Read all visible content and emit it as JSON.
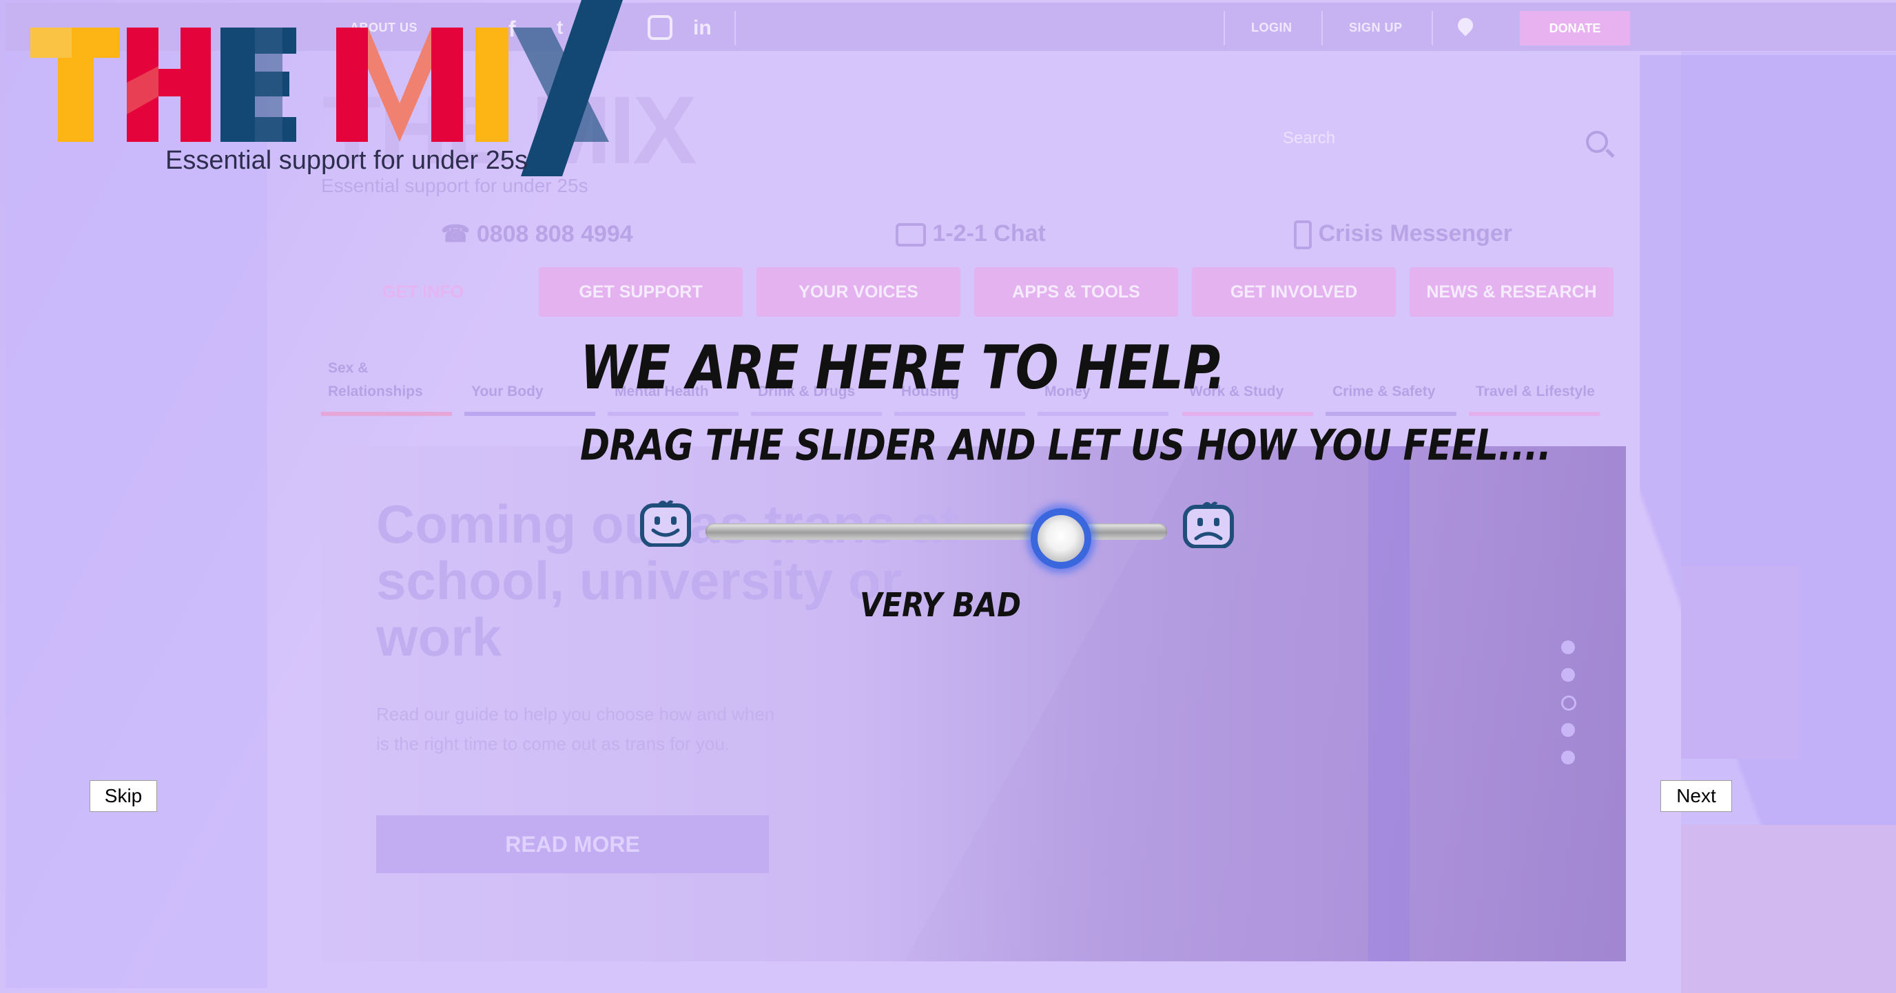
{
  "background_site": {
    "topbar": {
      "about_us": "ABOUT US",
      "login": "LOGIN",
      "sign_up": "SIGN UP",
      "donate": "DONATE"
    },
    "logo_ghost": "THE MIX",
    "tagline": "Essential support for under 25s",
    "search_placeholder": "Search",
    "contacts": {
      "phone": "0808 808 4994",
      "chat": "1-2-1 Chat",
      "crisis": "Crisis Messenger"
    },
    "main_nav": [
      "GET INFO",
      "GET SUPPORT",
      "YOUR VOICES",
      "APPS & TOOLS",
      "GET INVOLVED",
      "NEWS & RESEARCH"
    ],
    "sub_nav": [
      "Sex & Relationships",
      "Your Body",
      "Mental Health",
      "Drink & Drugs",
      "Housing",
      "Money",
      "Work & Study",
      "Crime & Safety",
      "Travel & Lifestyle"
    ],
    "hero": {
      "title": "Coming out as trans at school, university or work",
      "description": "Read our guide to help you choose how and when is the right time to come out as trans for you.",
      "button": "READ MORE"
    }
  },
  "overlay": {
    "logo_text": "THE MIX",
    "logo_tagline": "Essential support for under 25s",
    "headline": "We are here to help.",
    "subheadline": "Drag the slider and let us how you feel....",
    "slider": {
      "left_icon": "happy-face-icon",
      "right_icon": "sad-face-icon",
      "value_label": "Very Bad",
      "value": 0.77
    },
    "skip_label": "Skip",
    "next_label": "Next"
  },
  "colors": {
    "overlay_bg": "#d6c5fb",
    "logo_yellow": "#fdb516",
    "logo_red": "#e4033b",
    "logo_navy": "#134774",
    "slider_accent": "#3a67de"
  }
}
